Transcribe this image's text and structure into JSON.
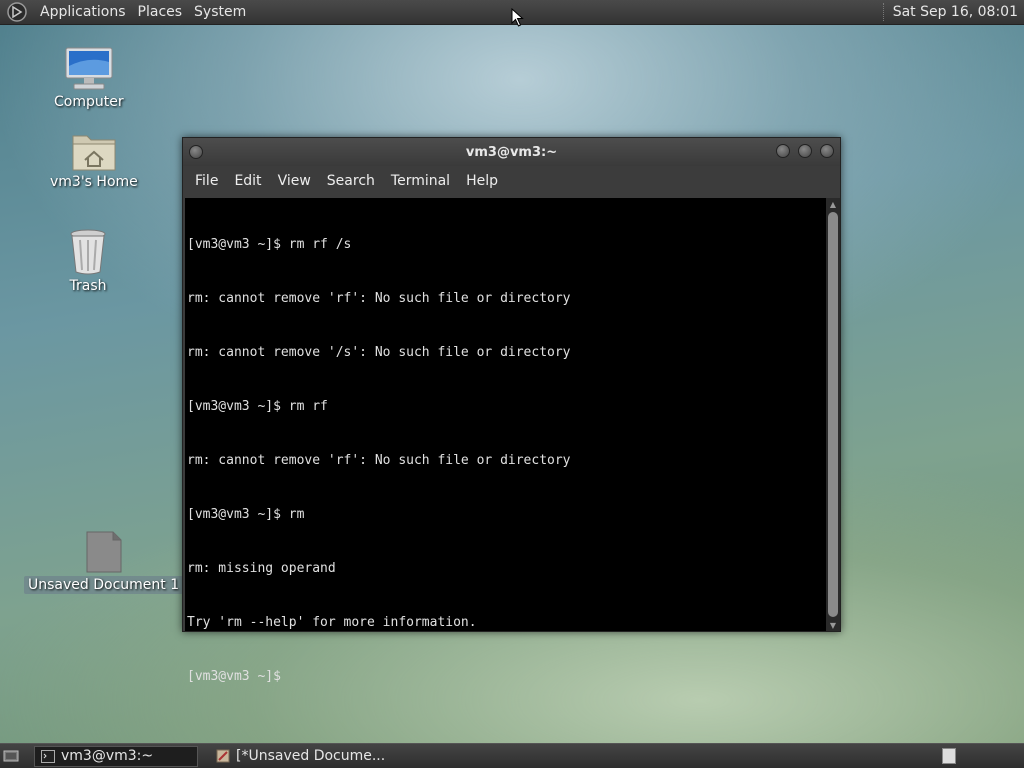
{
  "top_panel": {
    "menus": [
      "Applications",
      "Places",
      "System"
    ],
    "clock": "Sat Sep 16, 08:01"
  },
  "desktop": {
    "icons": [
      {
        "label": "Computer",
        "icon": "computer-icon"
      },
      {
        "label": "vm3's Home",
        "icon": "home-folder-icon"
      },
      {
        "label": "Trash",
        "icon": "trash-icon"
      },
      {
        "label": "Unsaved Document 1",
        "icon": "document-icon"
      }
    ]
  },
  "window": {
    "title": "vm3@vm3:~",
    "menu": [
      "File",
      "Edit",
      "View",
      "Search",
      "Terminal",
      "Help"
    ],
    "terminal_lines": [
      "[vm3@vm3 ~]$ rm rf /s",
      "rm: cannot remove 'rf': No such file or directory",
      "rm: cannot remove '/s': No such file or directory",
      "[vm3@vm3 ~]$ rm rf",
      "rm: cannot remove 'rf': No such file or directory",
      "[vm3@vm3 ~]$ rm",
      "rm: missing operand",
      "Try 'rm --help' for more information.",
      "[vm3@vm3 ~]$"
    ]
  },
  "taskbar": {
    "tasks": [
      {
        "label": "vm3@vm3:~",
        "icon": "terminal-icon",
        "active": true
      },
      {
        "label": "[*Unsaved Docume...",
        "icon": "text-editor-icon",
        "active": false
      }
    ]
  },
  "colors": {
    "panel": "#3a3a3a",
    "terminal_bg": "#000000",
    "terminal_fg": "#e0e0e0"
  }
}
